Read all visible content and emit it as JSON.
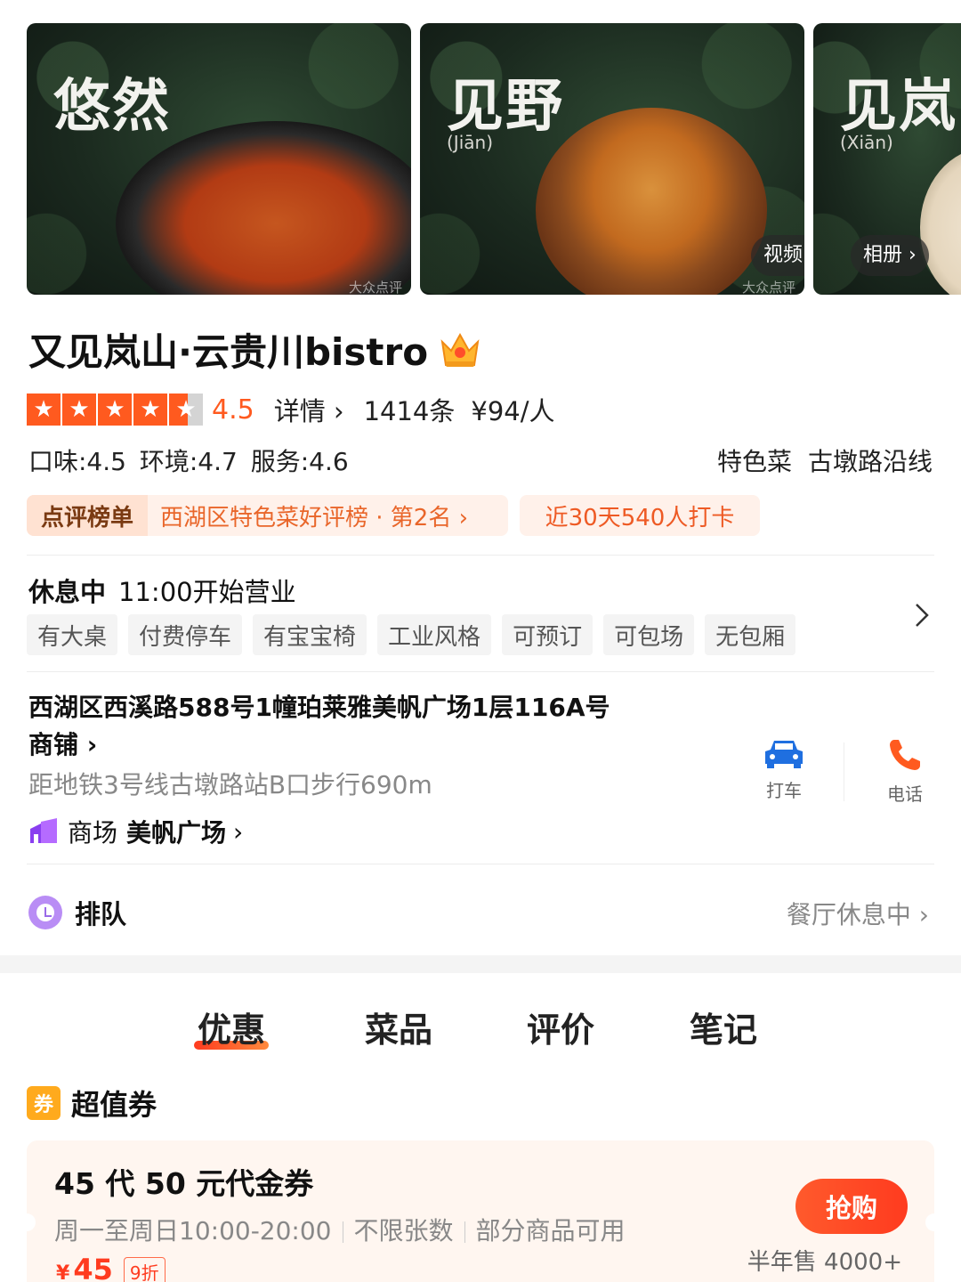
{
  "gallery": {
    "photos": [
      {
        "title": "悠然",
        "pinyin": "",
        "watermark": "大众点评"
      },
      {
        "title": "见野",
        "pinyin": "(Jiān)",
        "watermark": "大众点评"
      },
      {
        "title": "见岚",
        "pinyin": "(Xiān)",
        "watermark": ""
      }
    ],
    "video_label": "视频",
    "album_label": "相册"
  },
  "shop": {
    "name": "又见岚山·云贵川bistro",
    "rating": "4.5",
    "stars_value": 4.5,
    "details_label": "详情",
    "review_count": "1414条",
    "avg_price": "¥94/人",
    "sub_scores": "口味:4.5  环境:4.7  服务:4.6",
    "tags": [
      "特色菜",
      "古墩路沿线"
    ]
  },
  "rank": {
    "title": "点评榜单",
    "text": "西湖区特色菜好评榜 · 第2名",
    "checkin": "近30天540人打卡"
  },
  "hours": {
    "state": "休息中",
    "open_time": "11:00开始营业",
    "facilities": [
      "有大桌",
      "付费停车",
      "有宝宝椅",
      "工业风格",
      "可预订",
      "可包场",
      "无包厢"
    ]
  },
  "location": {
    "address_line1": "西湖区西溪路588号1幢珀莱雅美帆广场1层116A号",
    "address_line2": "商铺",
    "metro": "距地铁3号线古墩路站B口步行690m",
    "mall_label": "商场",
    "mall_name": "美帆广场",
    "taxi_label": "打车",
    "phone_label": "电话"
  },
  "queue": {
    "label": "排队",
    "status": "餐厅休息中"
  },
  "tabs": [
    "优惠",
    "菜品",
    "评价",
    "笔记"
  ],
  "coupons": {
    "section_title": "超值券",
    "icon_char": "券",
    "item": {
      "title": "45 代 50 元代金券",
      "time": "周一至周日10:00-20:00",
      "limit": "不限张数",
      "scope": "部分商品可用",
      "currency": "¥",
      "price": "45",
      "discount": "9折",
      "buy_label": "抢购",
      "sold": "半年售 4000+"
    }
  },
  "colors": {
    "accent": "#ff5a1f",
    "rank_text": "#e9662a",
    "taxi": "#1f6fe0",
    "phone": "#ff5a1f"
  }
}
